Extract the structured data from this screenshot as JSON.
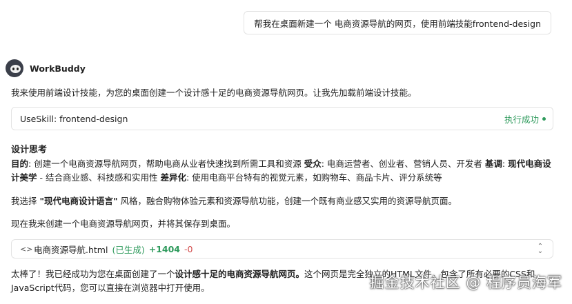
{
  "user_message": "帮我在桌面新建一个 电商资源导航的网页，使用前端技能frontend-design",
  "agent": {
    "name": "WorkBuddy",
    "avatar_icon": "raccoon-avatar-icon"
  },
  "intro": "我来使用前端设计技能，为您的桌面创建一个设计感十足的电商资源导航网页。让我先加载前端设计技能。",
  "skill": {
    "label": "UseSkill: frontend-design",
    "status": "执行成功"
  },
  "design": {
    "title": "设计思考",
    "purpose_label": "目的",
    "purpose_text": ": 创建一个电商资源导航网页，帮助电商从业者快速找到所需工具和资源 ",
    "audience_label": "受众",
    "audience_text": ": 电商运营者、创业者、营销人员、开发者 ",
    "tone_label": "基调",
    "tone_sep": ": ",
    "tone_value": "现代电商设计美学",
    "tone_text": " - 结合商业感、科技感和实用性 ",
    "diff_label": "差异化",
    "diff_text": ": 使用电商平台特有的视觉元素，如购物车、商品卡片、评分系统等"
  },
  "choice": {
    "prefix": "我选择 ",
    "highlight": "\"现代电商设计语言\"",
    "suffix": " 风格，融合购物体验元素和资源导航功能，创建一个既有商业感又实用的资源导航页面。"
  },
  "creating": "现在我来创建一个电商资源导航网页，并将其保存到桌面。",
  "file": {
    "icon": "code-icon",
    "name": "电商资源导航.html",
    "status": "(已生成)",
    "added": "+1404",
    "removed": "-0"
  },
  "result": {
    "prefix": "太棒了！我已经成功为您在桌面创建了一个",
    "highlight": "设计感十足的电商资源导航网页。",
    "suffix": "这个网页是完全独立的HTML文件，包含了所有必要的CSS和JavaScript代码，您可以直接在浏览器中打开使用。"
  },
  "watermark": "掘金技术社区 @ 程序员海军",
  "colors": {
    "success": "#2e9a5c",
    "removed": "#d24a4a",
    "border": "#e3e3e3"
  }
}
